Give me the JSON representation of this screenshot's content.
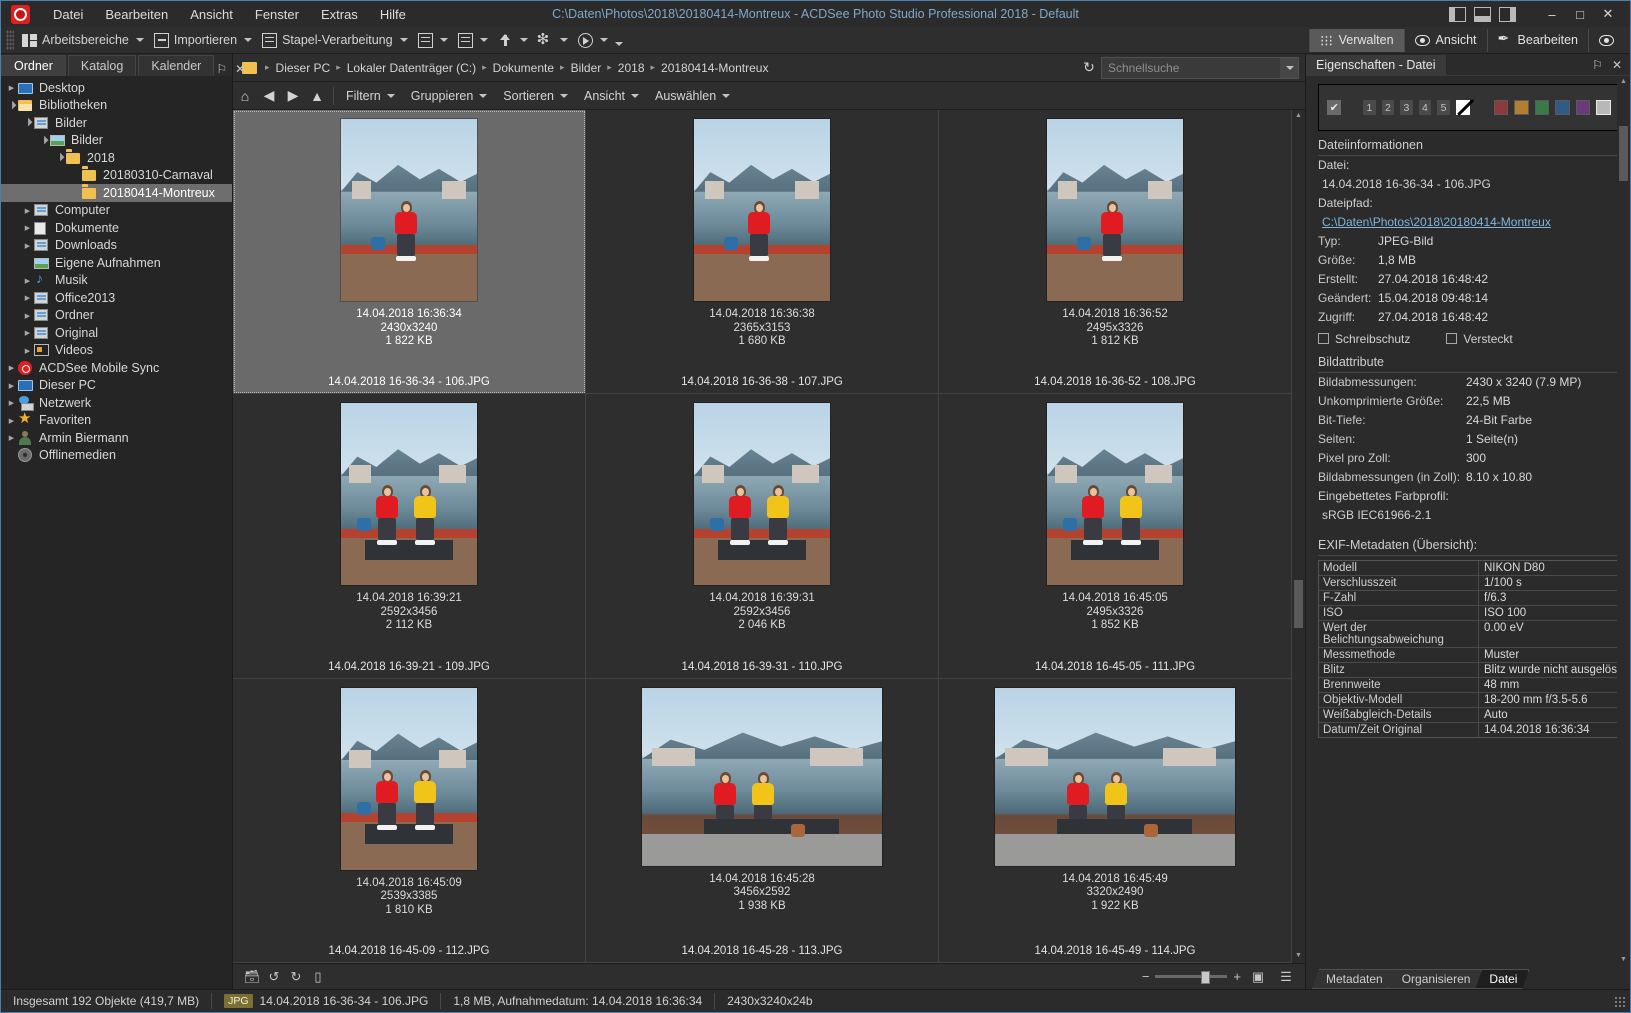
{
  "window": {
    "title": "C:\\Daten\\Photos\\2018\\20180414-Montreux - ACDSee Photo Studio Professional 2018 - Default",
    "minimize": "–",
    "maximize": "□",
    "close": "✕"
  },
  "menu": [
    "Datei",
    "Bearbeiten",
    "Ansicht",
    "Fenster",
    "Extras",
    "Hilfe"
  ],
  "toolbar": {
    "items": [
      {
        "label": "Arbeitsbereiche",
        "icon": "workspaces-icon",
        "caret": true
      },
      {
        "label": "Importieren",
        "icon": "import-icon",
        "caret": true
      },
      {
        "label": "Stapel-Verarbeitung",
        "icon": "batch-icon",
        "caret": true
      }
    ],
    "icon_only": [
      {
        "icon": "resize-icon",
        "caret": true
      },
      {
        "icon": "duplicate-icon",
        "caret": true
      },
      {
        "icon": "upload-icon",
        "caret": true
      },
      {
        "icon": "effects-icon",
        "caret": true
      },
      {
        "icon": "slideshow-icon",
        "caret": true
      }
    ]
  },
  "modes": [
    {
      "label": "Verwalten",
      "icon": "grid-icon",
      "active": true
    },
    {
      "label": "Ansicht",
      "icon": "eye-icon",
      "active": false
    },
    {
      "label": "Bearbeiten",
      "icon": "brush-icon",
      "active": false
    }
  ],
  "left_panel": {
    "tabs": [
      {
        "label": "Ordner",
        "active": true
      },
      {
        "label": "Katalog",
        "active": false
      },
      {
        "label": "Kalender",
        "active": false
      }
    ],
    "pin": "⚐",
    "close": "✕",
    "tree": [
      {
        "label": "Desktop",
        "indent": 0,
        "arrow": "closed",
        "icon": "monitor-icon",
        "selected": false
      },
      {
        "label": "Bibliotheken",
        "indent": 0,
        "arrow": "open",
        "icon": "library-icon",
        "selected": false
      },
      {
        "label": "Bilder",
        "indent": 1,
        "arrow": "open",
        "icon": "pc-icon",
        "selected": false
      },
      {
        "label": "Bilder",
        "indent": 2,
        "arrow": "open",
        "icon": "picture-icon",
        "selected": false
      },
      {
        "label": "2018",
        "indent": 3,
        "arrow": "open",
        "icon": "folder-icon",
        "selected": false
      },
      {
        "label": "20180310-Carnaval",
        "indent": 4,
        "arrow": "none",
        "icon": "folder-icon",
        "selected": false
      },
      {
        "label": "20180414-Montreux",
        "indent": 4,
        "arrow": "none",
        "icon": "folder-icon",
        "selected": true
      },
      {
        "label": "Computer",
        "indent": 1,
        "arrow": "closed",
        "icon": "pc-icon",
        "selected": false
      },
      {
        "label": "Dokumente",
        "indent": 1,
        "arrow": "closed",
        "icon": "document-icon",
        "selected": false
      },
      {
        "label": "Downloads",
        "indent": 1,
        "arrow": "closed",
        "icon": "pc-icon",
        "selected": false
      },
      {
        "label": "Eigene Aufnahmen",
        "indent": 1,
        "arrow": "none",
        "icon": "picture-icon",
        "selected": false
      },
      {
        "label": "Musik",
        "indent": 1,
        "arrow": "closed",
        "icon": "music-icon",
        "selected": false
      },
      {
        "label": "Office2013",
        "indent": 1,
        "arrow": "closed",
        "icon": "pc-icon",
        "selected": false
      },
      {
        "label": "Ordner",
        "indent": 1,
        "arrow": "closed",
        "icon": "pc-icon",
        "selected": false
      },
      {
        "label": "Original",
        "indent": 1,
        "arrow": "closed",
        "icon": "pc-icon",
        "selected": false
      },
      {
        "label": "Videos",
        "indent": 1,
        "arrow": "closed",
        "icon": "video-icon",
        "selected": false
      },
      {
        "label": "ACDSee Mobile Sync",
        "indent": 0,
        "arrow": "closed",
        "icon": "acdsee-icon",
        "selected": false
      },
      {
        "label": "Dieser PC",
        "indent": 0,
        "arrow": "closed",
        "icon": "monitor-icon",
        "selected": false
      },
      {
        "label": "Netzwerk",
        "indent": 0,
        "arrow": "closed",
        "icon": "network-icon",
        "selected": false
      },
      {
        "label": "Favoriten",
        "indent": 0,
        "arrow": "closed",
        "icon": "star-icon",
        "selected": false
      },
      {
        "label": "Armin Biermann",
        "indent": 0,
        "arrow": "closed",
        "icon": "user-icon",
        "selected": false
      },
      {
        "label": "Offlinemedien",
        "indent": 0,
        "arrow": "none",
        "icon": "offline-icon",
        "selected": false
      }
    ]
  },
  "breadcrumb": {
    "crumbs": [
      "Dieser PC",
      "Lokaler Datenträger (C:)",
      "Dokumente",
      "Bilder",
      "2018",
      "20180414-Montreux"
    ],
    "separator": "▸",
    "refresh_icon": "refresh-icon"
  },
  "search": {
    "placeholder": "Schnellsuche",
    "value": ""
  },
  "filterbar": {
    "nav": [
      "home-icon",
      "back-icon",
      "forward-icon",
      "up-icon"
    ],
    "items": [
      "Filtern",
      "Gruppieren",
      "Sortieren",
      "Ansicht",
      "Auswählen"
    ]
  },
  "thumbnails": [
    {
      "time": "14.04.2018 16:36:34",
      "dims": "2430x3240",
      "size": "1 822 KB",
      "file": "14.04.2018 16-36-34 - 106.JPG",
      "selected": true,
      "scene": "one-dock"
    },
    {
      "time": "14.04.2018 16:36:38",
      "dims": "2365x3153",
      "size": "1 680 KB",
      "file": "14.04.2018 16-36-38 - 107.JPG",
      "selected": false,
      "scene": "one-dock"
    },
    {
      "time": "14.04.2018 16:36:52",
      "dims": "2495x3326",
      "size": "1 812 KB",
      "file": "14.04.2018 16-36-52 - 108.JPG",
      "selected": false,
      "scene": "one-dock"
    },
    {
      "time": "14.04.2018 16:39:21",
      "dims": "2592x3456",
      "size": "2 112 KB",
      "file": "14.04.2018 16-39-21 - 109.JPG",
      "selected": false,
      "scene": "two-bench"
    },
    {
      "time": "14.04.2018 16:39:31",
      "dims": "2592x3456",
      "size": "2 046 KB",
      "file": "14.04.2018 16-39-31 - 110.JPG",
      "selected": false,
      "scene": "two-bench"
    },
    {
      "time": "14.04.2018 16:45:05",
      "dims": "2495x3326",
      "size": "1 852 KB",
      "file": "14.04.2018 16-45-05 - 111.JPG",
      "selected": false,
      "scene": "two-bench"
    },
    {
      "time": "14.04.2018 16:45:09",
      "dims": "2539x3385",
      "size": "1 810 KB",
      "file": "14.04.2018 16-45-09 - 112.JPG",
      "selected": false,
      "scene": "two-sit"
    },
    {
      "time": "14.04.2018 16:45:28",
      "dims": "3456x2592",
      "size": "1 938 KB",
      "file": "14.04.2018 16-45-28 - 113.JPG",
      "selected": false,
      "scene": "two-wide"
    },
    {
      "time": "14.04.2018 16:45:49",
      "dims": "3320x2490",
      "size": "1 922 KB",
      "file": "14.04.2018 16-45-49 - 114.JPG",
      "selected": false,
      "scene": "two-wide"
    }
  ],
  "browse_bar": {
    "icons": [
      "save-image-icon",
      "rotate-left-icon",
      "rotate-right-icon",
      "copy-icon"
    ],
    "zoom_out": "−",
    "zoom_in": "+",
    "view_icons": [
      "thumbnail-view-icon",
      "detail-view-icon"
    ]
  },
  "right_panel": {
    "title": "Eigenschaften - Datei",
    "pin": "⚐",
    "close": "✕",
    "rating": {
      "check": "✔",
      "numbers": [
        "1",
        "2",
        "3",
        "4",
        "5"
      ],
      "none_label": "none",
      "swatches": [
        "#8c3a3a",
        "#b08030",
        "#3a7a4a",
        "#2f5c86",
        "#6a3a7a",
        "#b8b8b8"
      ]
    },
    "section_file": "Dateiinformationen",
    "file": {
      "datei_label": "Datei:",
      "datei_value": "14.04.2018 16-36-34 - 106.JPG",
      "pfad_label": "Dateipfad:",
      "pfad_value": "C:\\Daten\\Photos\\2018\\20180414-Montreux",
      "rows": [
        {
          "k": "Typ:",
          "v": "JPEG-Bild"
        },
        {
          "k": "Größe:",
          "v": "1,8 MB"
        },
        {
          "k": "Erstellt:",
          "v": "27.04.2018 16:48:42"
        },
        {
          "k": "Geändert:",
          "v": "15.04.2018 09:48:14"
        },
        {
          "k": "Zugriff:",
          "v": "27.04.2018 16:48:42"
        }
      ],
      "checkboxes": [
        {
          "label": "Schreibschutz",
          "checked": false
        },
        {
          "label": "Versteckt",
          "checked": false
        }
      ]
    },
    "section_image": "Bildattribute",
    "image_rows": [
      {
        "k": "Bildabmessungen:",
        "v": "2430 x 3240 (7.9 MP)"
      },
      {
        "k": "Unkomprimierte Größe:",
        "v": "22,5 MB"
      },
      {
        "k": "Bit-Tiefe:",
        "v": "24-Bit Farbe"
      },
      {
        "k": "Seiten:",
        "v": "1 Seite(n)"
      },
      {
        "k": "Pixel pro Zoll:",
        "v": "300"
      },
      {
        "k": "Bildabmessungen (in Zoll):",
        "v": "8.10 x 10.80"
      }
    ],
    "color_profile_label": "Eingebettetes Farbprofil:",
    "color_profile_value": "sRGB IEC61966-2.1",
    "section_exif": "EXIF-Metadaten (Übersicht):",
    "exif": [
      {
        "k": "Modell",
        "v": "NIKON D80"
      },
      {
        "k": "Verschlusszeit",
        "v": "1/100 s"
      },
      {
        "k": "F-Zahl",
        "v": "f/6.3"
      },
      {
        "k": "ISO",
        "v": "ISO 100"
      },
      {
        "k": "Wert der Belichtungsabweichung",
        "v": "0.00 eV"
      },
      {
        "k": "Messmethode",
        "v": "Muster"
      },
      {
        "k": "Blitz",
        "v": "Blitz wurde nicht ausgelöst"
      },
      {
        "k": "Brennweite",
        "v": "48 mm"
      },
      {
        "k": "Objektiv-Modell",
        "v": "18-200 mm f/3.5-5.6"
      },
      {
        "k": "Weißabgleich-Details",
        "v": "Auto"
      },
      {
        "k": "Datum/Zeit Original",
        "v": "14.04.2018 16:36:34"
      }
    ],
    "tabs": [
      {
        "label": "Metadaten",
        "active": false
      },
      {
        "label": "Organisieren",
        "active": false
      },
      {
        "label": "Datei",
        "active": true
      }
    ]
  },
  "statusbar": {
    "total": "Insgesamt 192 Objekte  (419,7 MB)",
    "badge": "JPG",
    "filename": "14.04.2018 16-36-34 - 106.JPG",
    "info": "1,8 MB, Aufnahmedatum: 14.04.2018 16:36:34",
    "dims": "2430x3240x24b"
  }
}
